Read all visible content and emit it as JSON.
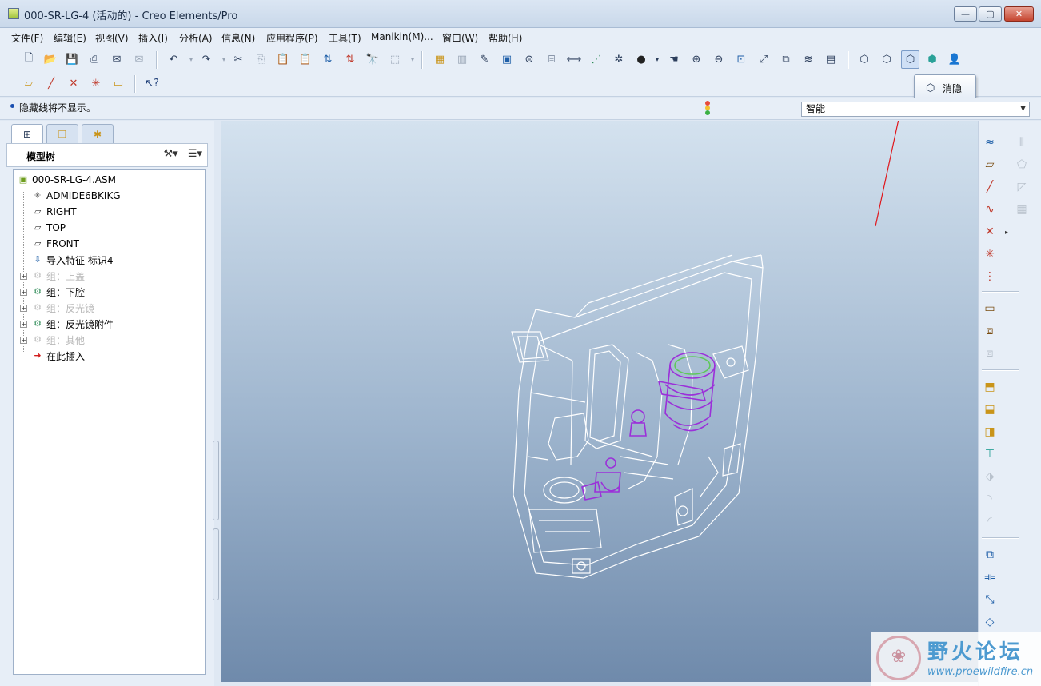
{
  "window": {
    "title": "000-SR-LG-4 (活动的) - Creo Elements/Pro",
    "min_glyph": "—",
    "max_glyph": "▢",
    "close_glyph": "✕"
  },
  "menu": [
    "文件(F)",
    "编辑(E)",
    "视图(V)",
    "插入(I)",
    "分析(A)",
    "信息(N)",
    "应用程序(P)",
    "工具(T)",
    "Manikin(M)...",
    "窗口(W)",
    "帮助(H)"
  ],
  "toolbar_icons": {
    "new": "new-file-icon",
    "open": "open-folder-icon",
    "save": "save-icon",
    "print": "print-icon",
    "undo": "undo-icon",
    "redo": "redo-icon",
    "cut": "cut-icon",
    "copy": "copy-icon",
    "paste": "paste-icon",
    "repaint": "repaint-icon",
    "zoom_in": "zoom-in-icon",
    "zoom_out": "zoom-out-icon",
    "refit": "refit-icon",
    "wireframe": "wireframe-icon",
    "hidden_line": "hidden-line-icon",
    "no_hidden": "no-hidden-icon",
    "shading": "shading-icon"
  },
  "message": {
    "text": "隐藏线将不显示。",
    "traffic_colors": [
      "#e84b3a",
      "#f2c12e",
      "#3cb043"
    ]
  },
  "filter": {
    "value": "智能"
  },
  "tooltip": {
    "label": "消隐"
  },
  "model_tree": {
    "header": "模型树",
    "items": [
      {
        "label": "000-SR-LG-4.ASM",
        "icon": "assembly-icon",
        "dim": false,
        "expander": false
      },
      {
        "label": "ADMIDE6BKIKG",
        "icon": "csys-icon",
        "dim": false,
        "expander": false
      },
      {
        "label": "RIGHT",
        "icon": "datum-plane-icon",
        "dim": false,
        "expander": false
      },
      {
        "label": "TOP",
        "icon": "datum-plane-icon",
        "dim": false,
        "expander": false
      },
      {
        "label": "FRONT",
        "icon": "datum-plane-icon",
        "dim": false,
        "expander": false
      },
      {
        "label": "导入特征 标识4",
        "icon": "import-feature-icon",
        "dim": false,
        "expander": false
      },
      {
        "label": "组：上盖",
        "icon": "group-icon",
        "dim": true,
        "expander": true
      },
      {
        "label": "组：下腔",
        "icon": "group-icon",
        "dim": false,
        "expander": true
      },
      {
        "label": "组：反光镜",
        "icon": "group-icon",
        "dim": true,
        "expander": true
      },
      {
        "label": "组：反光镜附件",
        "icon": "group-icon",
        "dim": false,
        "expander": true
      },
      {
        "label": "组：其他",
        "icon": "group-icon",
        "dim": true,
        "expander": true
      },
      {
        "label": "在此插入",
        "icon": "insert-here-icon",
        "dim": false,
        "expander": false
      }
    ]
  },
  "watermark": {
    "title": "野火论坛",
    "url": "www.proewildfire.cn"
  },
  "colors": {
    "viewport_top": "#d4e2ef",
    "viewport_bottom": "#6f8aab",
    "model_lines": "#ffffff",
    "model_highlight": "#9b30d9",
    "annotation_arrow": "#e0161b"
  }
}
